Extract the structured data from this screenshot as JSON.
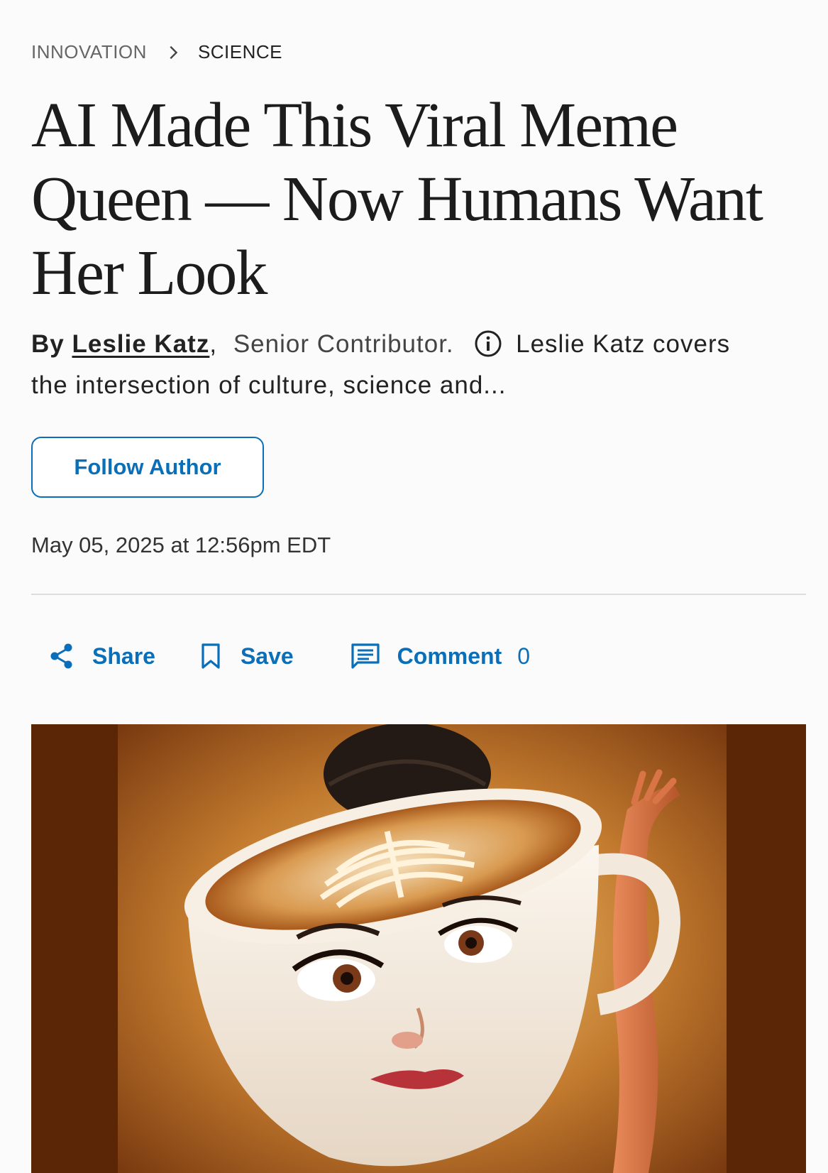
{
  "breadcrumb": {
    "section": "INNOVATION",
    "subsection": "SCIENCE"
  },
  "headline": "AI Made This Viral Meme Queen — Now Humans Want Her Look",
  "byline": {
    "prefix": "By",
    "author": "Leslie Katz",
    "comma": ",",
    "role": "Senior Contributor.",
    "bio": "Leslie Katz covers the intersection of culture, science and..."
  },
  "follow_button": "Follow Author",
  "published": "May 05, 2025 at 12:56pm EDT",
  "actions": {
    "share": "Share",
    "save": "Save",
    "comment": "Comment",
    "comment_count": "0"
  },
  "colors": {
    "accent": "#0a6fb8",
    "hero_border": "#5a2606",
    "text": "#222222"
  },
  "icons": [
    "chevron-right-icon",
    "info-icon",
    "share-icon",
    "bookmark-icon",
    "comment-icon"
  ]
}
